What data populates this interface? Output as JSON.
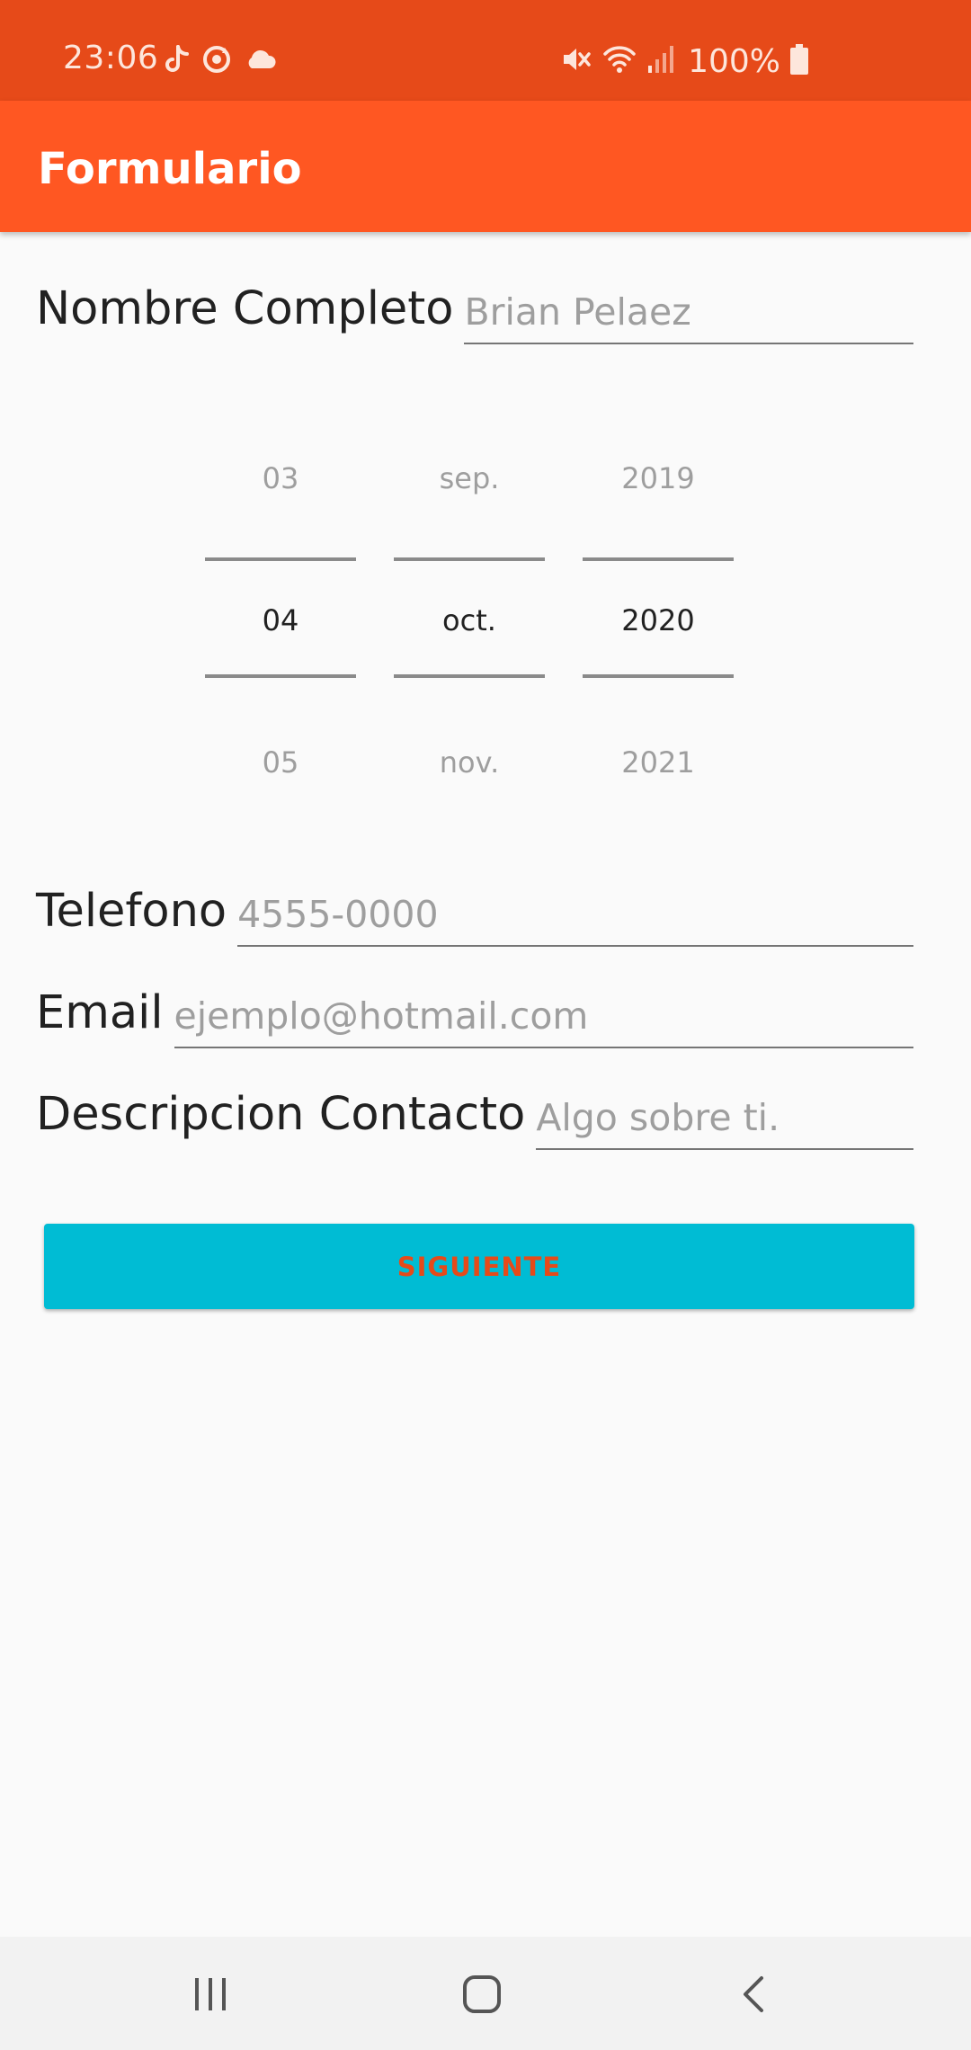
{
  "status_bar": {
    "time": "23:06",
    "battery": "100%",
    "left_icons": [
      "tiktok-icon",
      "sync-icon",
      "cloud-icon"
    ],
    "right_icons": [
      "mute-icon",
      "wifi-icon",
      "signal-icon",
      "battery-icon"
    ]
  },
  "app_bar": {
    "title": "Formulario",
    "color": "#ff5722"
  },
  "form": {
    "name": {
      "label": "Nombre Completo",
      "placeholder": "Brian Pelaez",
      "value": ""
    },
    "date_picker": {
      "day": {
        "prev": "03",
        "current": "04",
        "next": "05"
      },
      "month": {
        "prev": "sep.",
        "current": "oct.",
        "next": "nov."
      },
      "year": {
        "prev": "2019",
        "current": "2020",
        "next": "2021"
      }
    },
    "phone": {
      "label": "Telefono",
      "placeholder": "4555-0000",
      "value": ""
    },
    "email": {
      "label": "Email",
      "placeholder": "ejemplo@hotmail.com",
      "value": ""
    },
    "description": {
      "label": "Descripcion Contacto",
      "placeholder": "Algo sobre ti.",
      "value": ""
    },
    "next_button": {
      "label": "SIGUIENTE",
      "background": "#00bcd4",
      "text_color": "#e64a19"
    }
  },
  "nav_bar": {
    "buttons": [
      "recent-apps-icon",
      "home-icon",
      "back-icon"
    ]
  }
}
